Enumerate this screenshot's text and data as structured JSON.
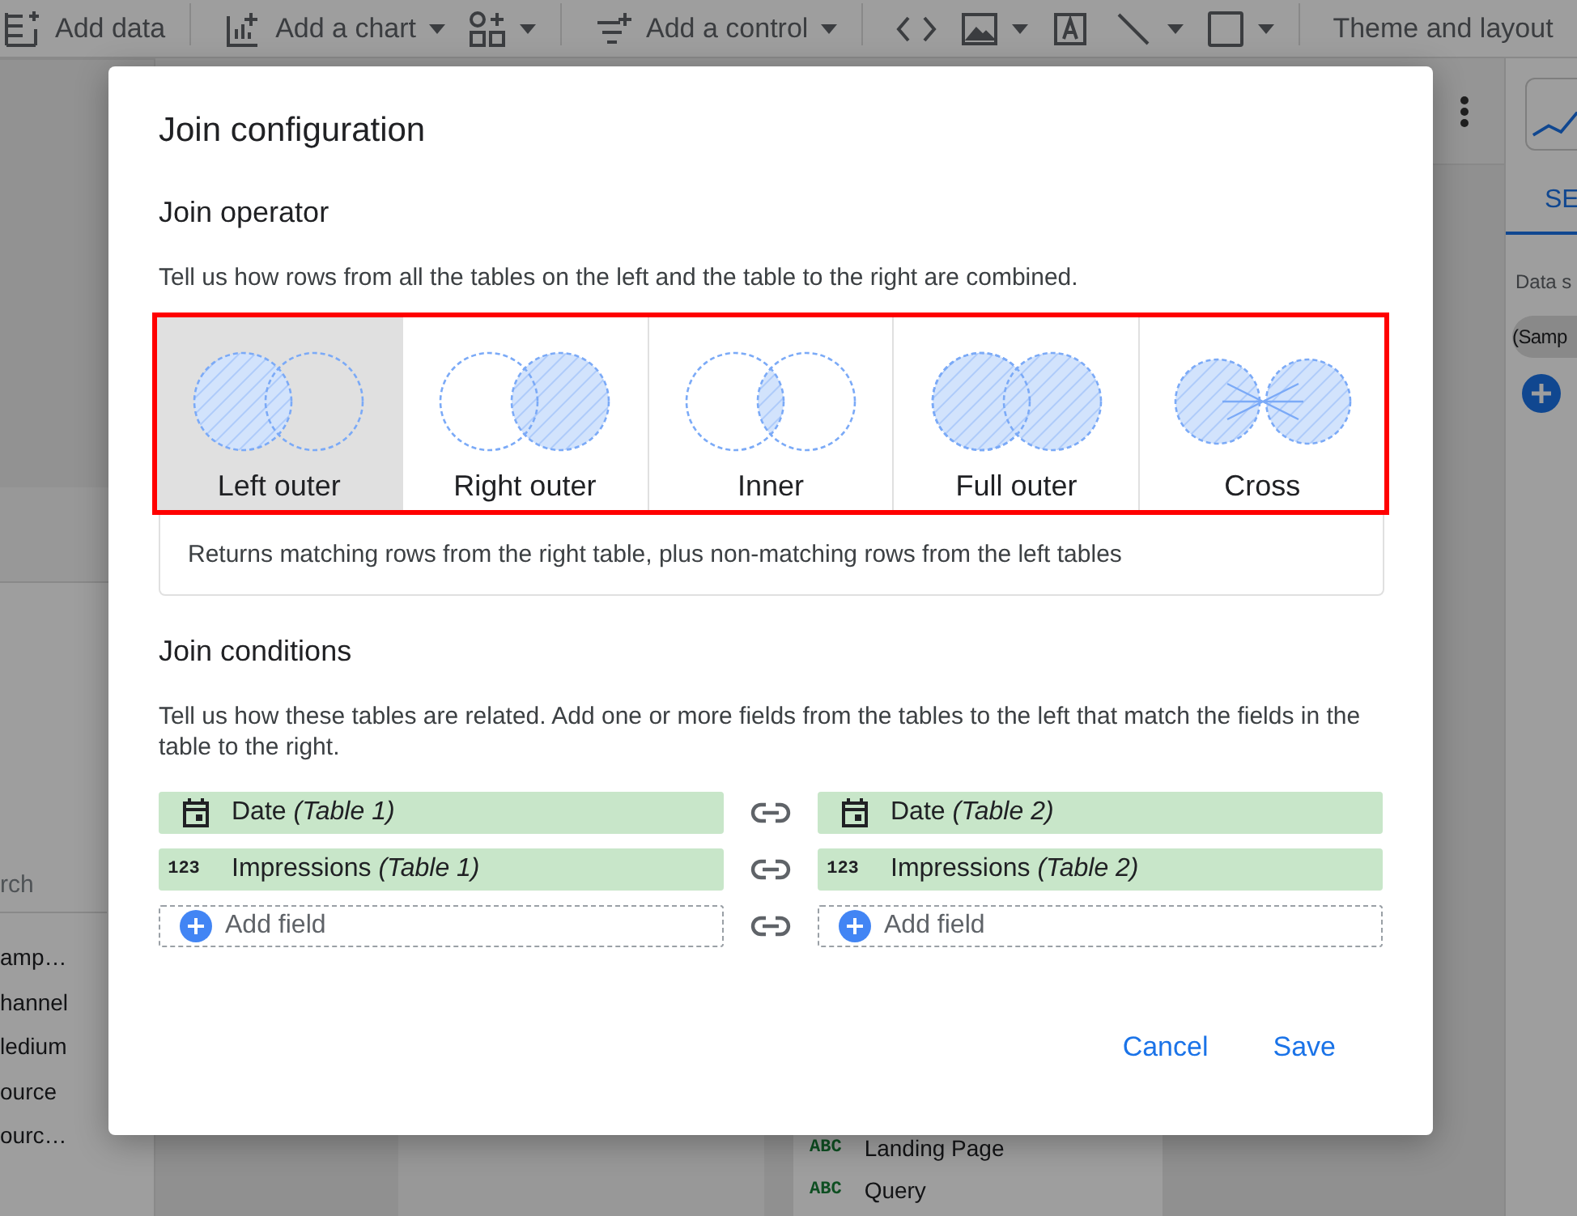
{
  "toolbar": {
    "items": [
      {
        "kind": "add-data",
        "label": "Add data",
        "dropdown": false,
        "divider_after": true
      },
      {
        "kind": "chart",
        "label": "Add a chart",
        "dropdown": true,
        "divider_after": false
      },
      {
        "kind": "shapes",
        "dropdown": true,
        "divider_after": true
      },
      {
        "kind": "control",
        "label": "Add a control",
        "dropdown": true,
        "divider_after": true
      },
      {
        "kind": "code",
        "dropdown": false,
        "divider_after": false
      },
      {
        "kind": "image",
        "dropdown": true,
        "divider_after": false
      },
      {
        "kind": "textbox",
        "dropdown": false,
        "divider_after": false
      },
      {
        "kind": "line",
        "dropdown": true,
        "divider_after": false
      },
      {
        "kind": "rectangle",
        "dropdown": true,
        "divider_after": true
      },
      {
        "kind": "theme",
        "label": "Theme and layout",
        "dropdown": false,
        "divider_after": false
      }
    ]
  },
  "left_panel": {
    "search_placeholder": "rch",
    "fields": [
      "amp…",
      "hannel",
      "ledium",
      "ource",
      "ourc…"
    ]
  },
  "right_panel": {
    "tab": "SE",
    "data_source_label": "Data s",
    "data_source": "(Samp"
  },
  "dimension_list": [
    {
      "type_label": "ABC",
      "name": "Landing Page"
    },
    {
      "type_label": "ABC",
      "name": "Query"
    }
  ],
  "dialog": {
    "title": "Join configuration",
    "operator_heading": "Join operator",
    "operator_hint": "Tell us how rows from all the tables on the left and the table to the right are combined.",
    "operators": [
      {
        "kind": "left",
        "label": "Left outer",
        "selected": true
      },
      {
        "kind": "right",
        "label": "Right outer",
        "selected": false
      },
      {
        "kind": "inner",
        "label": "Inner",
        "selected": false
      },
      {
        "kind": "full",
        "label": "Full outer",
        "selected": false
      },
      {
        "kind": "cross",
        "label": "Cross",
        "selected": false
      }
    ],
    "operator_description": "Returns matching rows from the right table, plus non-matching rows from the left tables",
    "conditions_heading": "Join conditions",
    "conditions_hint": "Tell us how these tables are related. Add one or more fields from the tables to the left that match the fields in the table to the right.",
    "conditions": [
      {
        "left": {
          "kind": "date",
          "text": "Date *(Table 1)*"
        },
        "right": {
          "kind": "date",
          "text": "Date *(Table 2)*"
        }
      },
      {
        "left": {
          "kind": "number",
          "type_label": "123",
          "text": "Impressions *(Table 1)*"
        },
        "right": {
          "kind": "number",
          "type_label": "123",
          "text": "Impressions *(Table 2)*"
        }
      },
      {
        "left": {
          "kind": "add",
          "text": "Add field"
        },
        "right": {
          "kind": "add",
          "text": "Add field"
        }
      }
    ],
    "buttons": [
      {
        "kind": "text",
        "label": "Cancel"
      },
      {
        "kind": "text",
        "label": "Save"
      }
    ]
  }
}
